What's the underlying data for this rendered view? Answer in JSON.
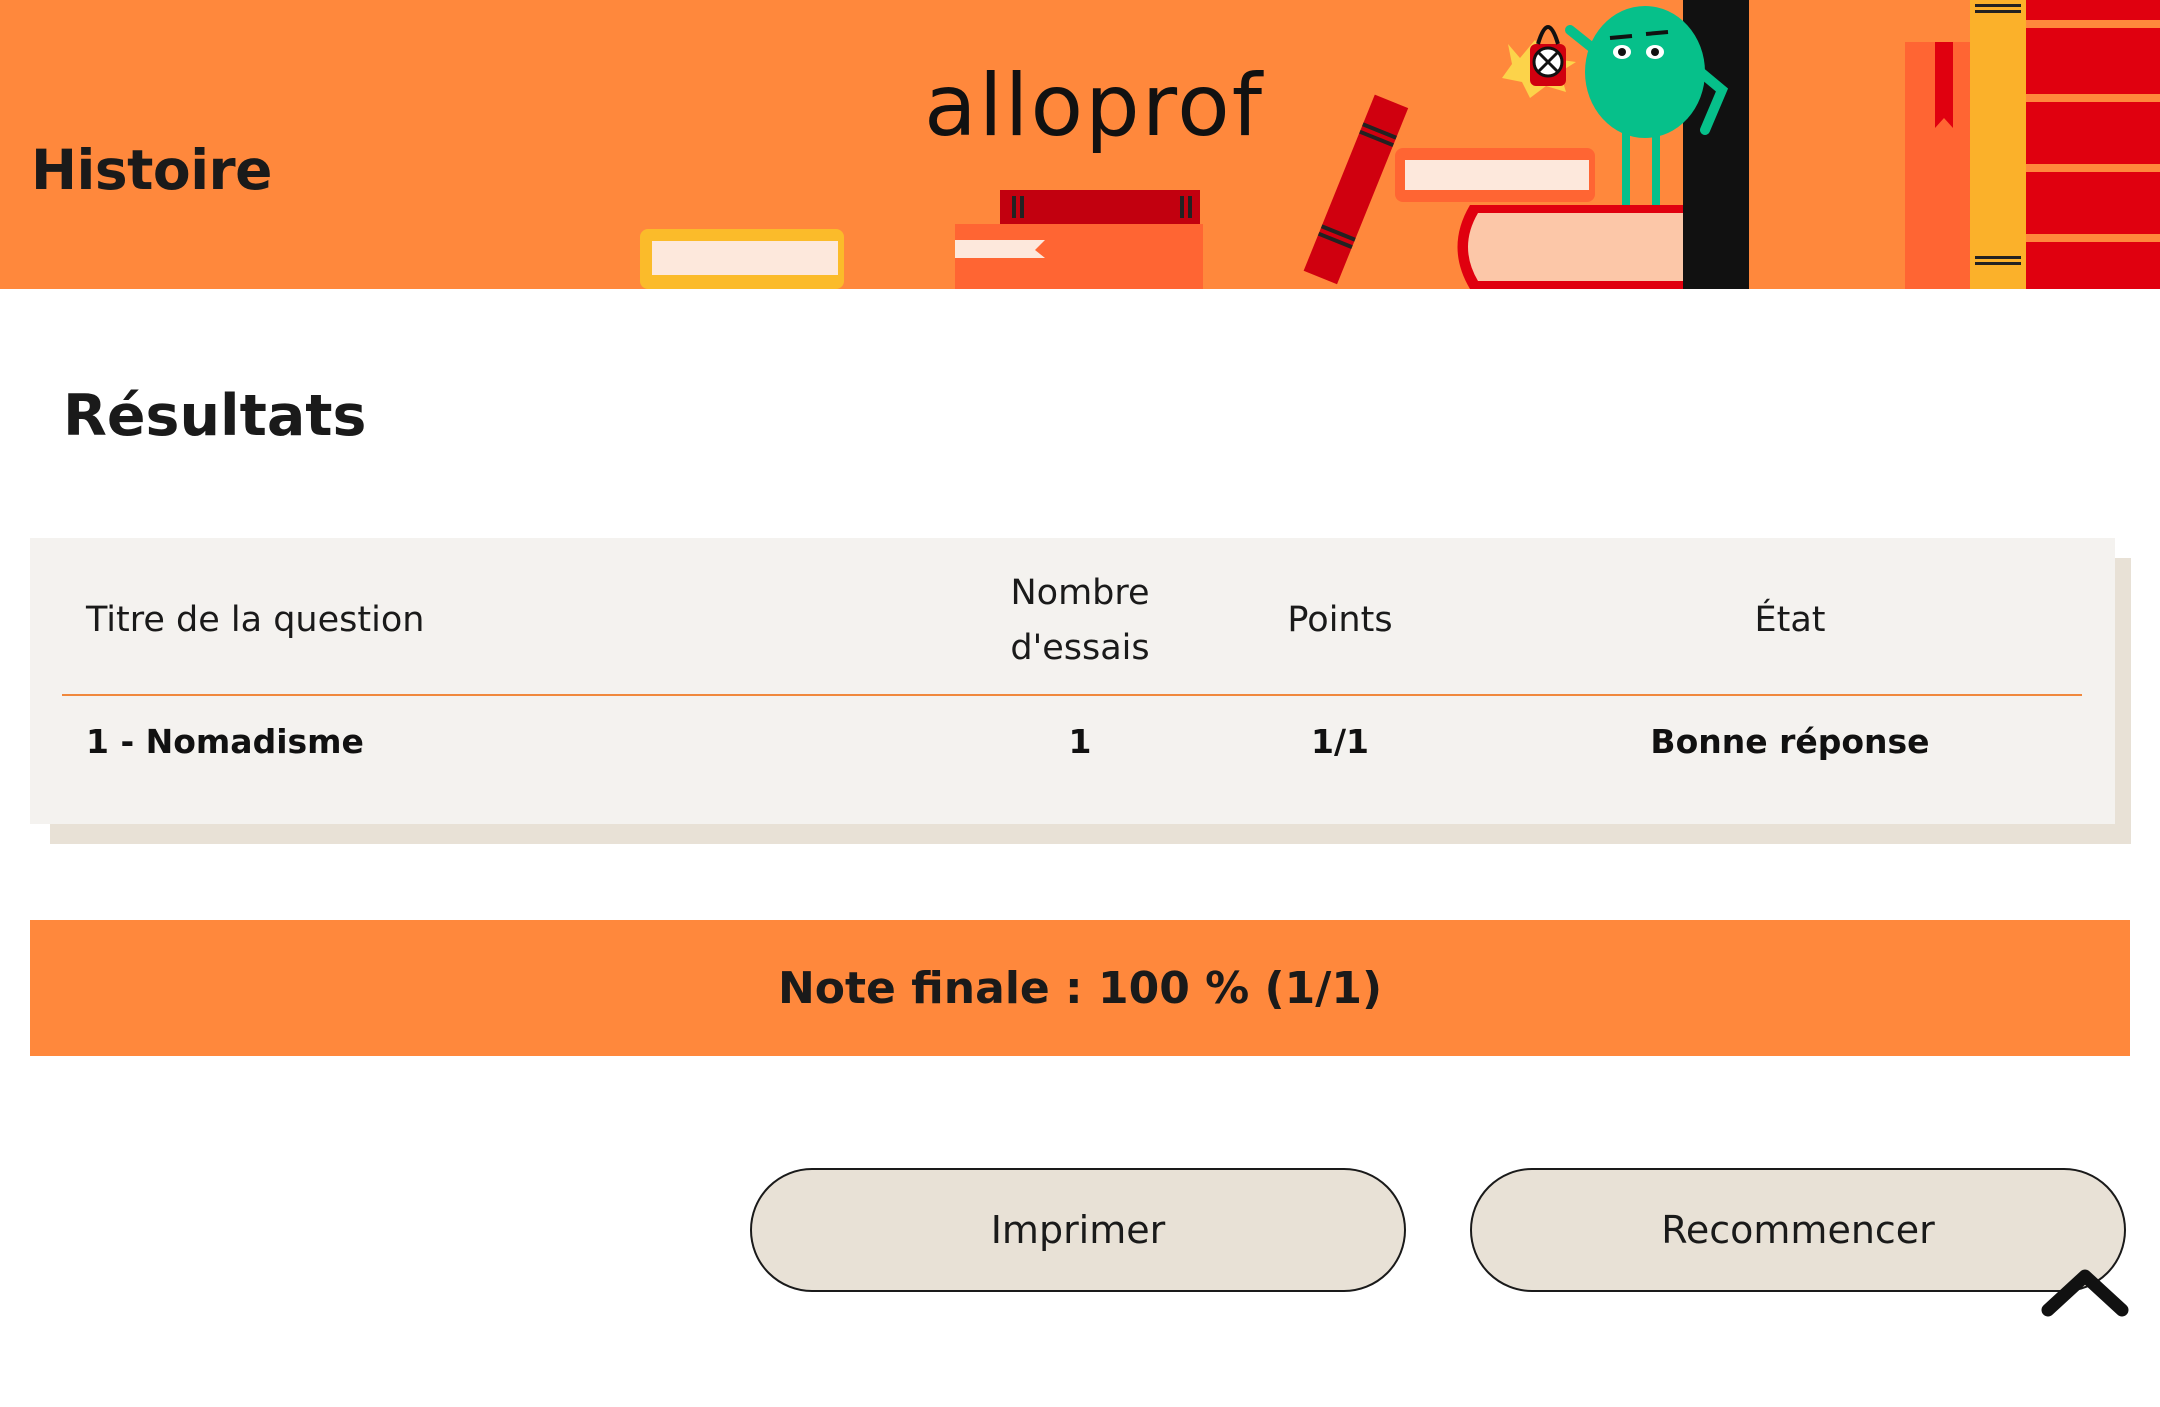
{
  "header": {
    "subject": "Histoire",
    "logo_text": "alloprof"
  },
  "results": {
    "heading": "Résultats",
    "columns": {
      "title": "Titre de la question",
      "tries_line1": "Nombre",
      "tries_line2": "d'essais",
      "points": "Points",
      "state": "État"
    },
    "rows": [
      {
        "title": "1 - Nomadisme",
        "tries": "1",
        "points": "1/1",
        "state": "Bonne réponse"
      }
    ]
  },
  "final": {
    "text": "Note finale : 100 % (1/1)"
  },
  "actions": {
    "print_label": "Imprimer",
    "restart_label": "Recommencer"
  },
  "icons": {
    "scroll_top": "chevron-up-icon",
    "mascot": "mascot-illustration"
  },
  "colors": {
    "accent": "#ff883c",
    "card_bg": "#f4f2ef",
    "button_bg": "#e8e1d6"
  }
}
